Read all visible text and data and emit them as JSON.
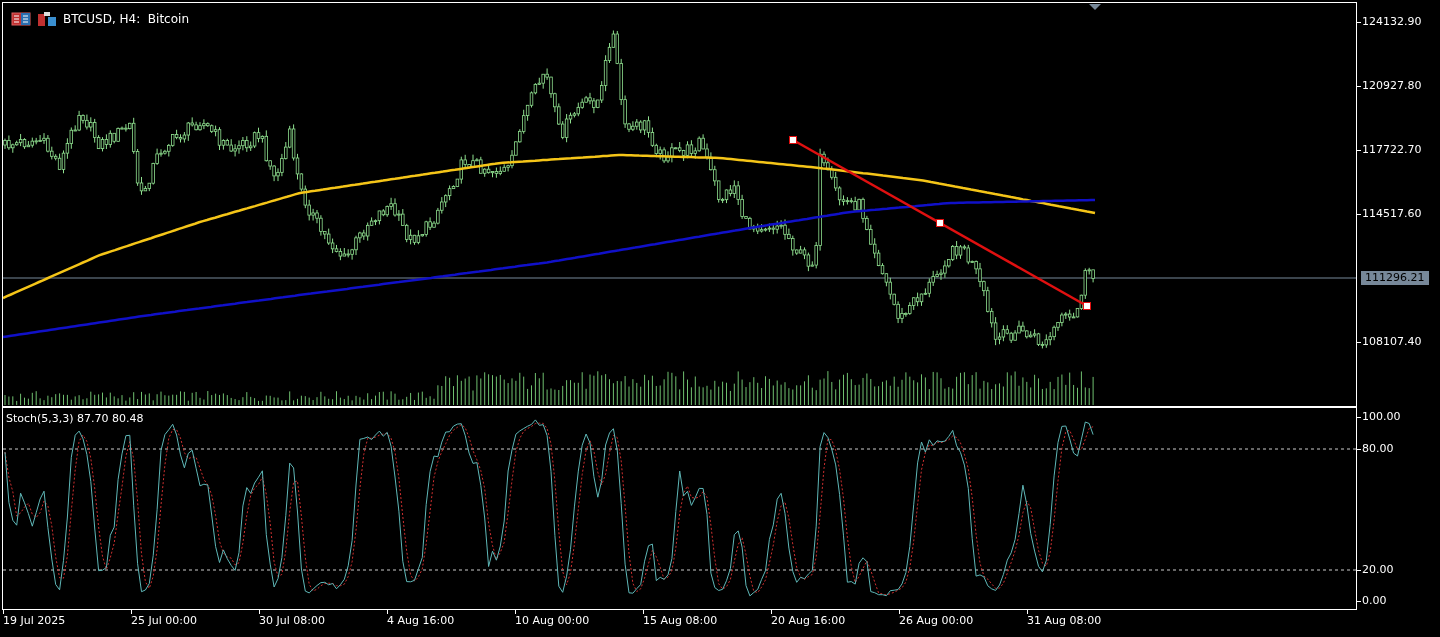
{
  "header": {
    "symbol_title": "BTCUSD, H4:  Bitcoin"
  },
  "price_axis": {
    "labels": [
      "124132.90",
      "120927.80",
      "117722.70",
      "114517.60",
      "108107.40"
    ],
    "current_price": "111296.21"
  },
  "stochastic": {
    "title": "Stoch(5,3,3) 87.70 80.48",
    "levels": [
      "100.00",
      "80.00",
      "20.00",
      "0.00"
    ]
  },
  "time_axis": {
    "labels": [
      "19 Jul 2025",
      "25 Jul 00:00",
      "30 Jul 08:00",
      "4 Aug 16:00",
      "10 Aug 00:00",
      "15 Aug 08:00",
      "20 Aug 16:00",
      "26 Aug 00:00",
      "31 Aug 08:00"
    ]
  }
}
